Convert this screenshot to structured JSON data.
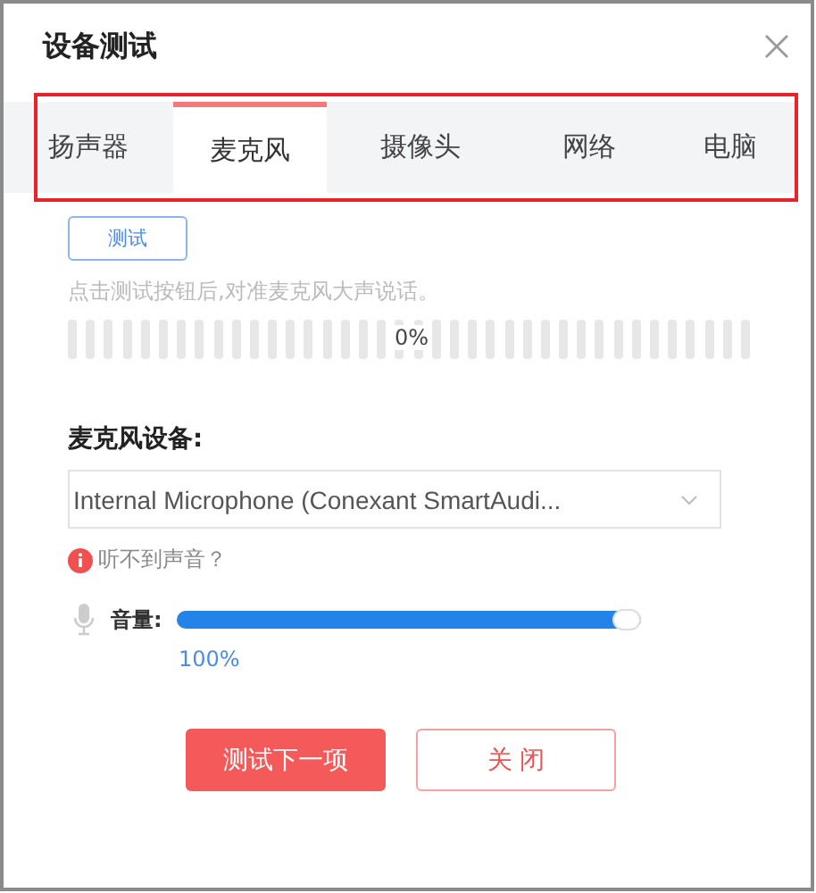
{
  "window": {
    "title": "设备测试"
  },
  "tabs": [
    {
      "label": "扬声器",
      "selected": false
    },
    {
      "label": "麦克风",
      "selected": true
    },
    {
      "label": "摄像头",
      "selected": false
    },
    {
      "label": "网络",
      "selected": false
    },
    {
      "label": "电脑",
      "selected": false
    }
  ],
  "test_button": "测试",
  "hint": "点击测试按钮后,对准麦克风大声说话。",
  "input_meter": {
    "reading": "0%"
  },
  "device_label": "麦克风设备:",
  "device_select": {
    "value": "Internal Microphone (Conexant SmartAudi..."
  },
  "help_link": "听不到声音？",
  "volume": {
    "label": "音量:",
    "level": 1,
    "reading": "100%"
  },
  "buttons": [
    {
      "label": "测试下一项",
      "kind": "primary"
    },
    {
      "label": "关 闭",
      "kind": "secondary"
    }
  ]
}
